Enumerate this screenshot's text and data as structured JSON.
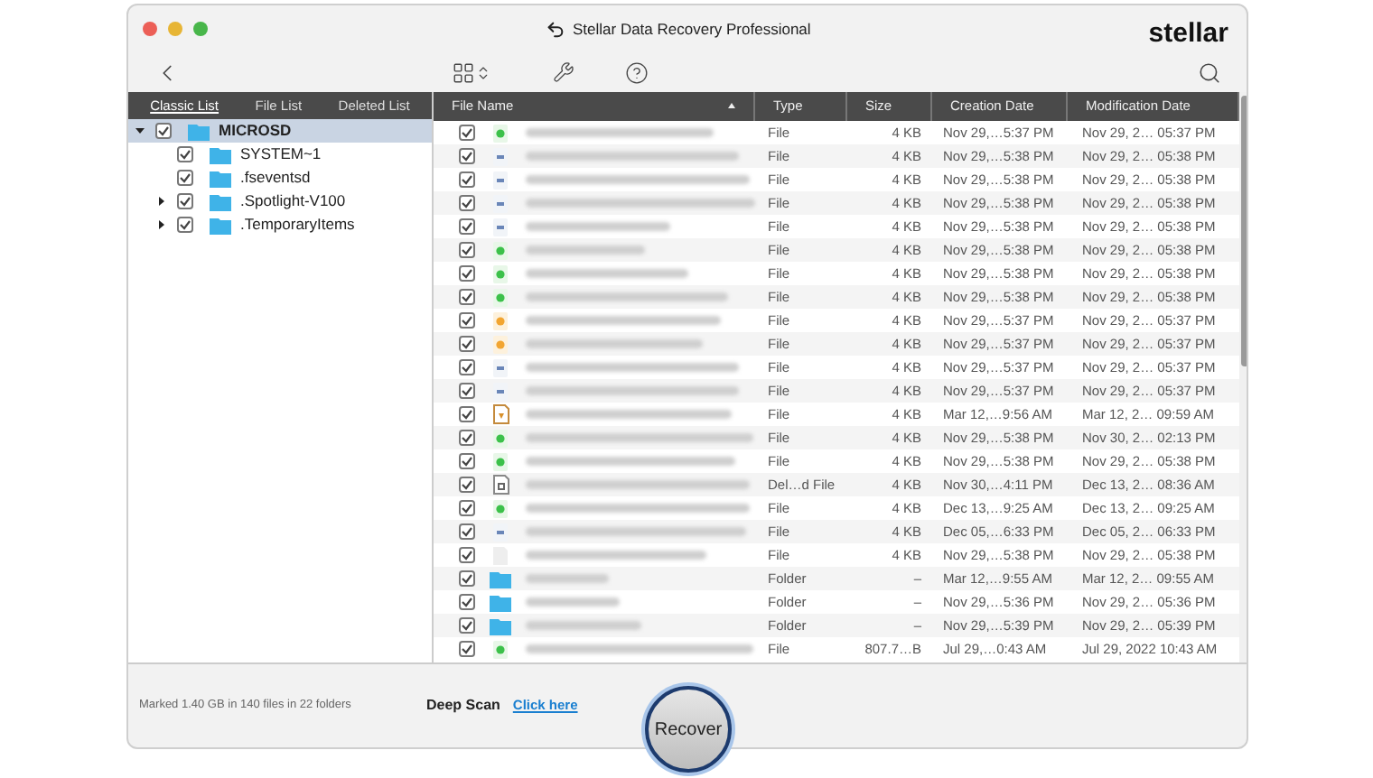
{
  "window": {
    "title": "Stellar Data Recovery Professional",
    "logo": "stellar"
  },
  "view_tabs": [
    {
      "label": "Classic List",
      "selected": true
    },
    {
      "label": "File List",
      "selected": false
    },
    {
      "label": "Deleted List",
      "selected": false
    }
  ],
  "tree": [
    {
      "label": "MICROSD",
      "checked": true,
      "expanded": true,
      "selected": true,
      "children": [
        {
          "label": "SYSTEM~1",
          "checked": true,
          "selected": false
        },
        {
          "label": ".fseventsd",
          "checked": true,
          "selected": false
        },
        {
          "label": ".Spotlight-V100",
          "checked": true,
          "expanded": false,
          "selected": false,
          "has_children": true
        },
        {
          "label": ".TemporaryItems",
          "checked": true,
          "expanded": false,
          "selected": false,
          "has_children": true
        }
      ]
    }
  ],
  "table": {
    "columns": [
      "File Name",
      "Type",
      "Size",
      "Creation Date",
      "Modification Date"
    ],
    "rows": [
      {
        "kind": "sheet",
        "checked": true,
        "type": "File",
        "size": "4 KB",
        "created": "Nov 29,…5:37 PM",
        "modified": "Nov 29, 2… 05:37 PM"
      },
      {
        "kind": "image",
        "checked": true,
        "type": "File",
        "size": "4 KB",
        "created": "Nov 29,…5:38 PM",
        "modified": "Nov 29, 2… 05:38 PM"
      },
      {
        "kind": "image",
        "checked": true,
        "type": "File",
        "size": "4 KB",
        "created": "Nov 29,…5:38 PM",
        "modified": "Nov 29, 2… 05:38 PM"
      },
      {
        "kind": "image",
        "checked": true,
        "type": "File",
        "size": "4 KB",
        "created": "Nov 29,…5:38 PM",
        "modified": "Nov 29, 2… 05:38 PM"
      },
      {
        "kind": "image",
        "checked": true,
        "type": "File",
        "size": "4 KB",
        "created": "Nov 29,…5:38 PM",
        "modified": "Nov 29, 2… 05:38 PM"
      },
      {
        "kind": "sheet",
        "checked": true,
        "type": "File",
        "size": "4 KB",
        "created": "Nov 29,…5:38 PM",
        "modified": "Nov 29, 2… 05:38 PM"
      },
      {
        "kind": "sheet",
        "checked": true,
        "type": "File",
        "size": "4 KB",
        "created": "Nov 29,…5:38 PM",
        "modified": "Nov 29, 2… 05:38 PM"
      },
      {
        "kind": "sheet",
        "checked": true,
        "type": "File",
        "size": "4 KB",
        "created": "Nov 29,…5:38 PM",
        "modified": "Nov 29, 2… 05:38 PM"
      },
      {
        "kind": "slides",
        "checked": true,
        "type": "File",
        "size": "4 KB",
        "created": "Nov 29,…5:37 PM",
        "modified": "Nov 29, 2… 05:37 PM"
      },
      {
        "kind": "slides",
        "checked": true,
        "type": "File",
        "size": "4 KB",
        "created": "Nov 29,…5:37 PM",
        "modified": "Nov 29, 2… 05:37 PM"
      },
      {
        "kind": "image",
        "checked": true,
        "type": "File",
        "size": "4 KB",
        "created": "Nov 29,…5:37 PM",
        "modified": "Nov 29, 2… 05:37 PM"
      },
      {
        "kind": "image",
        "checked": true,
        "type": "File",
        "size": "4 KB",
        "created": "Nov 29,…5:37 PM",
        "modified": "Nov 29, 2… 05:37 PM"
      },
      {
        "kind": "archive",
        "checked": true,
        "type": "File",
        "size": "4 KB",
        "created": "Mar 12,…9:56 AM",
        "modified": "Mar 12, 2… 09:59 AM"
      },
      {
        "kind": "sheet",
        "checked": true,
        "type": "File",
        "size": "4 KB",
        "created": "Nov 29,…5:38 PM",
        "modified": "Nov 30, 2… 02:13 PM"
      },
      {
        "kind": "sheet",
        "checked": true,
        "type": "File",
        "size": "4 KB",
        "created": "Nov 29,…5:38 PM",
        "modified": "Nov 29, 2… 05:38 PM"
      },
      {
        "kind": "document",
        "checked": true,
        "type": "Del…d File",
        "size": "4 KB",
        "created": "Nov 30,…4:11 PM",
        "modified": "Dec 13, 2… 08:36 AM"
      },
      {
        "kind": "sheet",
        "checked": true,
        "type": "File",
        "size": "4 KB",
        "created": "Dec 13,…9:25 AM",
        "modified": "Dec 13, 2… 09:25 AM"
      },
      {
        "kind": "image",
        "checked": true,
        "type": "File",
        "size": "4 KB",
        "created": "Dec 05,…6:33 PM",
        "modified": "Dec 05, 2… 06:33 PM"
      },
      {
        "kind": "text",
        "checked": true,
        "type": "File",
        "size": "4 KB",
        "created": "Nov 29,…5:38 PM",
        "modified": "Nov 29, 2… 05:38 PM"
      },
      {
        "kind": "folder",
        "checked": true,
        "type": "Folder",
        "size": "–",
        "created": "Mar 12,…9:55 AM",
        "modified": "Mar 12, 2… 09:55 AM"
      },
      {
        "kind": "folder",
        "checked": true,
        "type": "Folder",
        "size": "–",
        "created": "Nov 29,…5:36 PM",
        "modified": "Nov 29, 2… 05:36 PM"
      },
      {
        "kind": "folder",
        "checked": true,
        "type": "Folder",
        "size": "–",
        "created": "Nov 29,…5:39 PM",
        "modified": "Nov 29, 2… 05:39 PM"
      },
      {
        "kind": "sheet",
        "checked": true,
        "type": "File",
        "size": "807.7…B",
        "created": "Jul 29,…0:43 AM",
        "modified": "Jul 29, 2022 10:43 AM"
      }
    ]
  },
  "status": {
    "summary": "Marked 1.40 GB in 140 files in 22 folders",
    "deep_scan_label": "Deep Scan",
    "deep_scan_link": "Click here"
  },
  "recover_button": "Recover"
}
